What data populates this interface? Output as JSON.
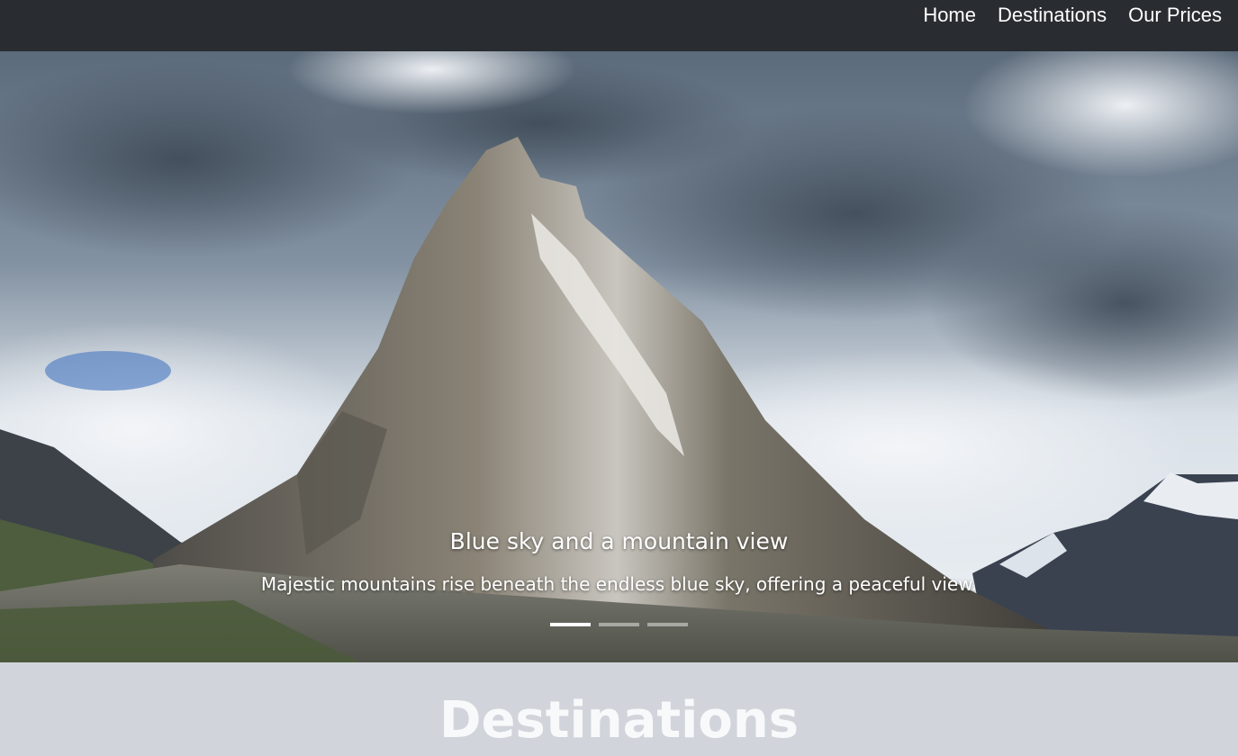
{
  "nav": {
    "items": [
      "Home",
      "Destinations",
      "Our Prices"
    ]
  },
  "carousel": {
    "slide_image": "mountain-peak-photo",
    "caption_title": "Blue sky and a mountain view",
    "caption_text": "Majestic mountains rise beneath the endless blue sky, offering a peaceful view.",
    "slide_count": 3,
    "active_slide": 1
  },
  "section": {
    "title": "Destinations"
  },
  "colors": {
    "navbar_bg": "#292d31",
    "section_bg": "#d1d5db",
    "text_light": "#ffffff"
  }
}
